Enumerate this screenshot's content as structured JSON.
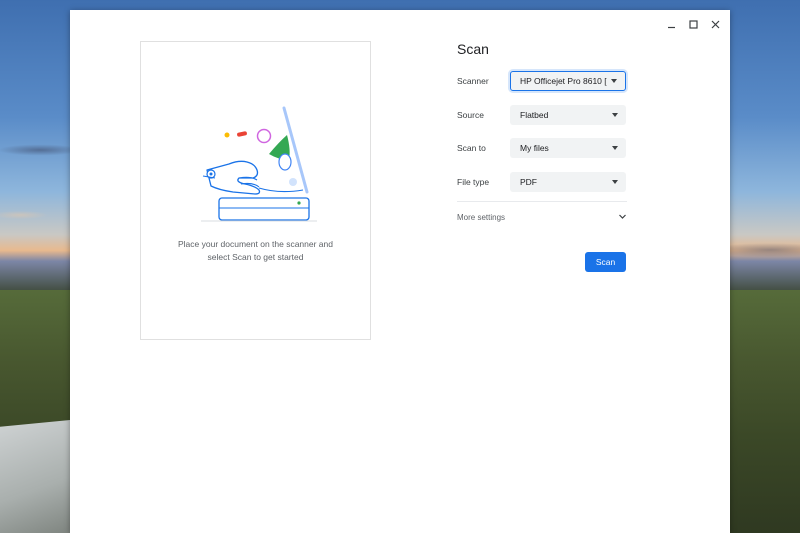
{
  "window_controls": {
    "minimize_icon": "minimize-icon",
    "maximize_icon": "maximize-icon",
    "close_icon": "close-icon"
  },
  "preview": {
    "illustration_icon": "scanner-illustration",
    "message_line1": "Place your document on the scanner and",
    "message_line2": "select Scan to get started"
  },
  "settings": {
    "title": "Scan",
    "rows": [
      {
        "label": "Scanner",
        "value": "HP Officejet Pro 8610 [...",
        "focused": true
      },
      {
        "label": "Source",
        "value": "Flatbed"
      },
      {
        "label": "Scan to",
        "value": "My files"
      },
      {
        "label": "File type",
        "value": "PDF"
      }
    ],
    "more_settings_label": "More settings",
    "scan_button_label": "Scan"
  },
  "colors": {
    "accent": "#1a73e8",
    "select_bg": "#f1f3f4",
    "text_primary": "#202124",
    "text_secondary": "#5f6368"
  }
}
